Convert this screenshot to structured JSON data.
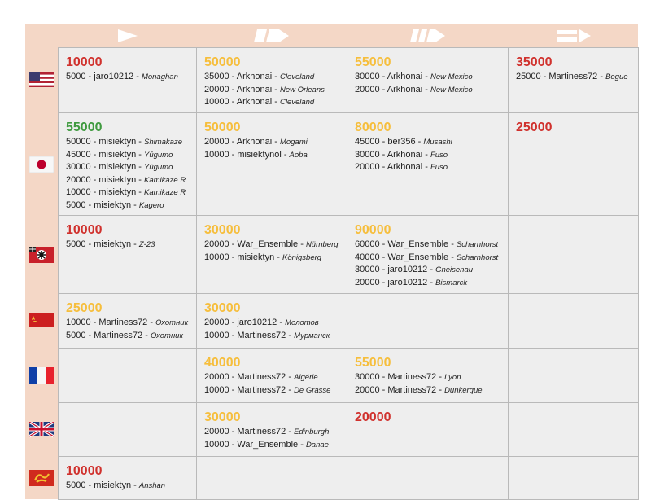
{
  "tier_headers": [
    {
      "icon": "arrow-tier-1-icon"
    },
    {
      "icon": "arrow-tier-2-icon"
    },
    {
      "icon": "arrow-tier-3-icon"
    },
    {
      "icon": "arrow-tier-4-icon"
    }
  ],
  "colors": {
    "red": "#d0312d",
    "gold": "#f6be3c",
    "green": "#3f9a3f",
    "header_bg": "#f4d7c6",
    "cell_bg": "#eeeeee"
  },
  "rows": [
    {
      "nation": "usa",
      "flag_icon": "usa-flag-icon",
      "cells": [
        {
          "total": "10000",
          "color": "red",
          "entries": [
            {
              "text": "5000 - jaro10212 - ",
              "ship": "Monaghan"
            }
          ]
        },
        {
          "total": "50000",
          "color": "gold",
          "entries": [
            {
              "text": "35000 - Arkhonai - ",
              "ship": "Cleveland"
            },
            {
              "text": "20000 - Arkhonai - ",
              "ship": "New Orleans"
            },
            {
              "text": "10000 - Arkhonai - ",
              "ship": "Cleveland"
            }
          ]
        },
        {
          "total": "55000",
          "color": "gold",
          "entries": [
            {
              "text": "30000 - Arkhonai - ",
              "ship": "New Mexico"
            },
            {
              "text": "20000 - Arkhonai - ",
              "ship": "New Mexico"
            }
          ]
        },
        {
          "total": "35000",
          "color": "red",
          "entries": [
            {
              "text": "25000 - Martiness72 - ",
              "ship": "Bogue"
            }
          ]
        }
      ]
    },
    {
      "nation": "japan",
      "flag_icon": "japan-flag-icon",
      "cells": [
        {
          "total": "55000",
          "color": "green",
          "entries": [
            {
              "text": "50000 - misiektyn - ",
              "ship": "Shimakaze"
            },
            {
              "text": "45000 - misiektyn - ",
              "ship": "Yūgumo"
            },
            {
              "text": "30000 - misiektyn - ",
              "ship": "Yūgumo"
            },
            {
              "text": "20000 - misiektyn - ",
              "ship": "Kamikaze R"
            },
            {
              "text": "10000 - misiektyn - ",
              "ship": "Kamikaze R"
            },
            {
              "text": "5000 - misiektyn - ",
              "ship": "Kagero"
            }
          ]
        },
        {
          "total": "50000",
          "color": "gold",
          "entries": [
            {
              "text": "20000 - Arkhonai - ",
              "ship": "Mogami"
            },
            {
              "text": "10000 - misiektynol - ",
              "ship": "Aoba"
            }
          ]
        },
        {
          "total": "80000",
          "color": "gold",
          "entries": [
            {
              "text": "45000 - ber356 - ",
              "ship": "Musashi"
            },
            {
              "text": "30000 - Arkhonai - ",
              "ship": "Fuso"
            },
            {
              "text": "20000 - Arkhonai - ",
              "ship": "Fuso"
            }
          ]
        },
        {
          "total": "25000",
          "color": "red",
          "entries": []
        }
      ]
    },
    {
      "nation": "germany",
      "flag_icon": "germany-flag-icon",
      "cells": [
        {
          "total": "10000",
          "color": "red",
          "entries": [
            {
              "text": "5000 - misiektyn - ",
              "ship": "Z-23"
            }
          ]
        },
        {
          "total": "30000",
          "color": "gold",
          "entries": [
            {
              "text": "20000 - War_Ensemble - ",
              "ship": "Nürnberg"
            },
            {
              "text": "10000 - misiektyn - ",
              "ship": "Königsberg"
            }
          ]
        },
        {
          "total": "90000",
          "color": "gold",
          "entries": [
            {
              "text": "60000 - War_Ensemble - ",
              "ship": "Scharnhorst"
            },
            {
              "text": "40000 - War_Ensemble - ",
              "ship": "Scharnhorst"
            },
            {
              "text": "30000 - jaro10212 - ",
              "ship": "Gneisenau"
            },
            {
              "text": "20000 - jaro10212 - ",
              "ship": "Bismarck"
            }
          ]
        },
        {
          "total": "",
          "color": "red",
          "entries": []
        }
      ]
    },
    {
      "nation": "ussr",
      "flag_icon": "ussr-flag-icon",
      "cells": [
        {
          "total": "25000",
          "color": "gold",
          "entries": [
            {
              "text": "10000 - Martiness72 - ",
              "ship": "Охотник"
            },
            {
              "text": "5000 - Martiness72 - ",
              "ship": "Охотник"
            }
          ]
        },
        {
          "total": "30000",
          "color": "gold",
          "entries": [
            {
              "text": "20000 - jaro10212 - ",
              "ship": "Молотов"
            },
            {
              "text": "10000 - Martiness72 - ",
              "ship": "Мурманск"
            }
          ]
        },
        {
          "total": "",
          "color": "red",
          "entries": []
        },
        {
          "total": "",
          "color": "red",
          "entries": []
        }
      ]
    },
    {
      "nation": "france",
      "flag_icon": "france-flag-icon",
      "cells": [
        {
          "total": "",
          "color": "red",
          "entries": []
        },
        {
          "total": "40000",
          "color": "gold",
          "entries": [
            {
              "text": "20000 - Martiness72 - ",
              "ship": "Algérie"
            },
            {
              "text": "10000 - Martiness72 - ",
              "ship": "De Grasse"
            }
          ]
        },
        {
          "total": "55000",
          "color": "gold",
          "entries": [
            {
              "text": "30000 - Martiness72 - ",
              "ship": "Lyon"
            },
            {
              "text": "20000 - Martiness72 - ",
              "ship": "Dunkerque"
            }
          ]
        },
        {
          "total": "",
          "color": "red",
          "entries": []
        }
      ]
    },
    {
      "nation": "uk",
      "flag_icon": "uk-flag-icon",
      "cells": [
        {
          "total": "",
          "color": "red",
          "entries": []
        },
        {
          "total": "30000",
          "color": "gold",
          "entries": [
            {
              "text": "20000 - Martiness72 - ",
              "ship": "Edinburgh"
            },
            {
              "text": "10000 - War_Ensemble - ",
              "ship": "Danae"
            }
          ]
        },
        {
          "total": "20000",
          "color": "red",
          "entries": []
        },
        {
          "total": "",
          "color": "red",
          "entries": []
        }
      ]
    },
    {
      "nation": "pan-asia",
      "flag_icon": "pan-asia-flag-icon",
      "cells": [
        {
          "total": "10000",
          "color": "red",
          "entries": [
            {
              "text": "5000 - misiektyn - ",
              "ship": "Anshan"
            }
          ]
        },
        {
          "total": "",
          "color": "red",
          "entries": []
        },
        {
          "total": "",
          "color": "red",
          "entries": []
        },
        {
          "total": "",
          "color": "red",
          "entries": []
        }
      ]
    }
  ]
}
